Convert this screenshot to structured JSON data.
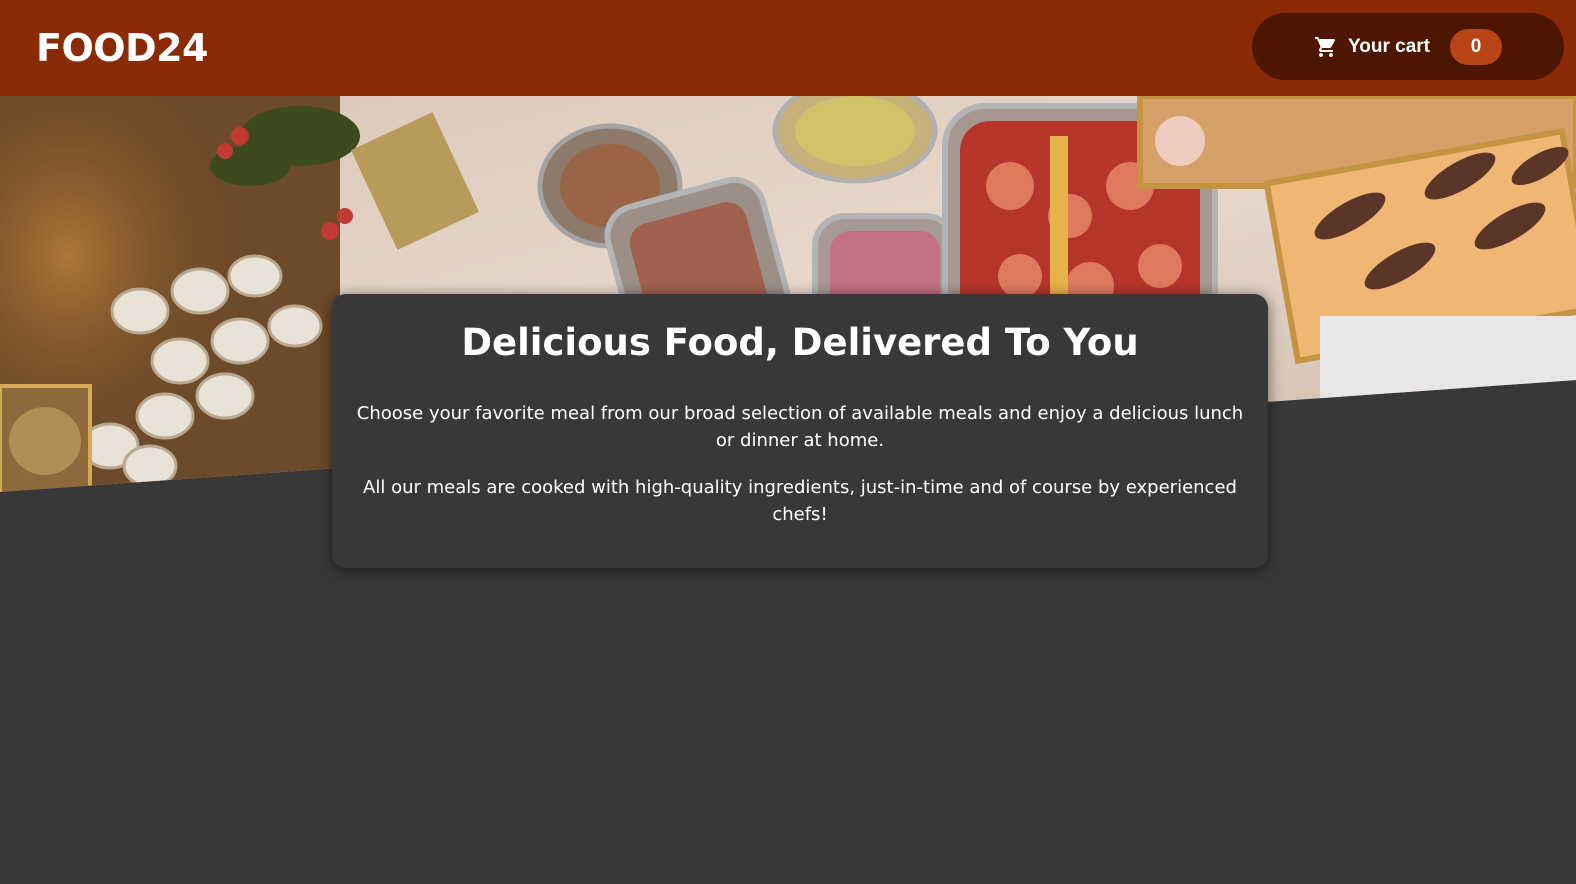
{
  "header": {
    "logo": "FOOD24",
    "cart": {
      "icon": "shopping-cart-icon",
      "label": "Your cart",
      "count": "0"
    }
  },
  "hero": {
    "image": "buffet-table-photo"
  },
  "summary": {
    "title": "Delicious Food, Delivered To You",
    "paragraphs": [
      "Choose your favorite meal from our broad selection of available meals and enjoy a delicious lunch or dinner at home.",
      "All our meals are cooked with high-quality ingredients, just-in-time and of course by experienced chefs!"
    ]
  },
  "colors": {
    "header_bg": "#8a2b06",
    "cart_button_bg": "#4d1601",
    "cart_badge_bg": "#b94517",
    "page_bg": "#383838"
  }
}
